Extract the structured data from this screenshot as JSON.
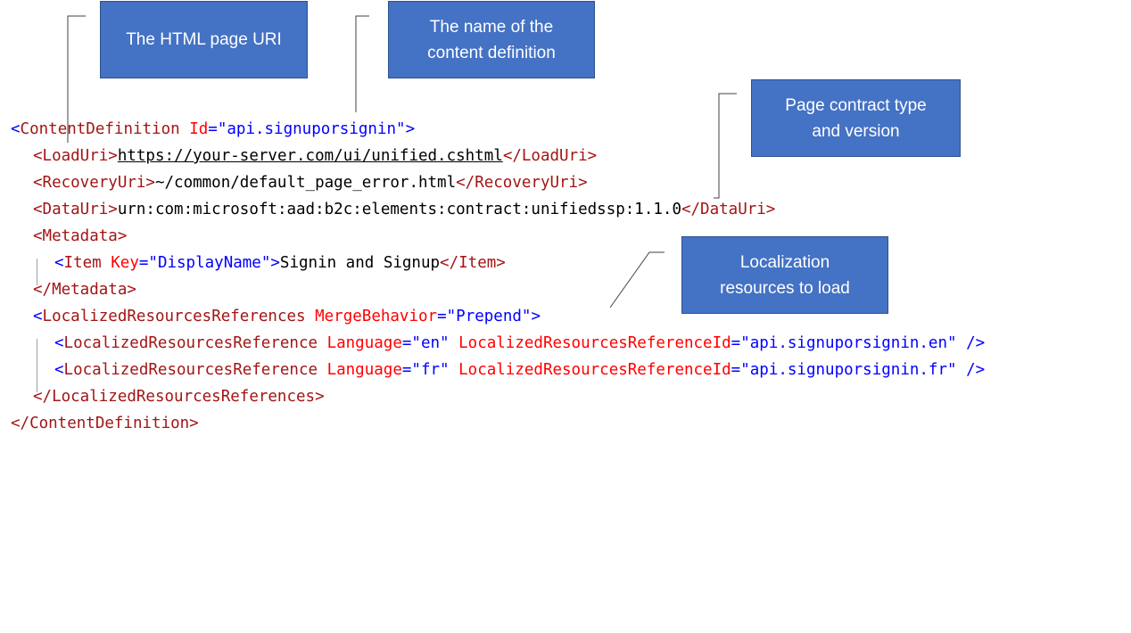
{
  "callouts": {
    "html_uri": [
      "The HTML page URI"
    ],
    "content_name": [
      "The name of the",
      "content definition"
    ],
    "page_contract": [
      "Page contract type",
      "and version"
    ],
    "localization": [
      "Localization",
      "resources to load"
    ]
  },
  "xml": {
    "l1": {
      "lt": "<",
      "tag": "ContentDefinition",
      "sp": " ",
      "attr": "Id",
      "eq": "=",
      "val": "\"api.signuporsignin\"",
      "gt": ">"
    },
    "l2": {
      "open": "<LoadUri>",
      "text": "https://your-server.com/ui/unified.cshtml",
      "close": "</LoadUri>"
    },
    "l3": {
      "open": "<RecoveryUri>",
      "text": "~/common/default_page_error.html",
      "close": "</RecoveryUri>"
    },
    "l4": {
      "open": "<DataUri>",
      "text": "urn:com:microsoft:aad:b2c:elements:contract:unifiedssp:1.1.0",
      "close": "</DataUri>"
    },
    "l5": {
      "open": "<Metadata>"
    },
    "l6": {
      "lt": "<",
      "tag": "Item",
      "sp": " ",
      "attr": "Key",
      "eq": "=",
      "val": "\"DisplayName\"",
      "gt": ">",
      "text": "Signin and Signup",
      "close": "</Item>"
    },
    "l7": {
      "close": "</Metadata>"
    },
    "l8": {
      "lt": "<",
      "tag": "LocalizedResourcesReferences",
      "sp": " ",
      "attr": "MergeBehavior",
      "eq": "=",
      "val": "\"Prepend\"",
      "gt": ">"
    },
    "l9": {
      "lt": "<",
      "tag": "LocalizedResourcesReference",
      "attr1": "Language",
      "val1": "\"en\"",
      "attr2": "LocalizedResourcesReferenceId",
      "val2": "\"api.signuporsignin.en\"",
      "end": " />"
    },
    "l10": {
      "lt": "<",
      "tag": "LocalizedResourcesReference",
      "attr1": "Language",
      "val1": "\"fr\"",
      "attr2": "LocalizedResourcesReferenceId",
      "val2": "\"api.signuporsignin.fr\"",
      "end": " />"
    },
    "l11": {
      "close": "</LocalizedResourcesReferences>"
    },
    "l12": {
      "close": "</ContentDefinition>"
    },
    "eq": "=",
    "sp": " "
  }
}
